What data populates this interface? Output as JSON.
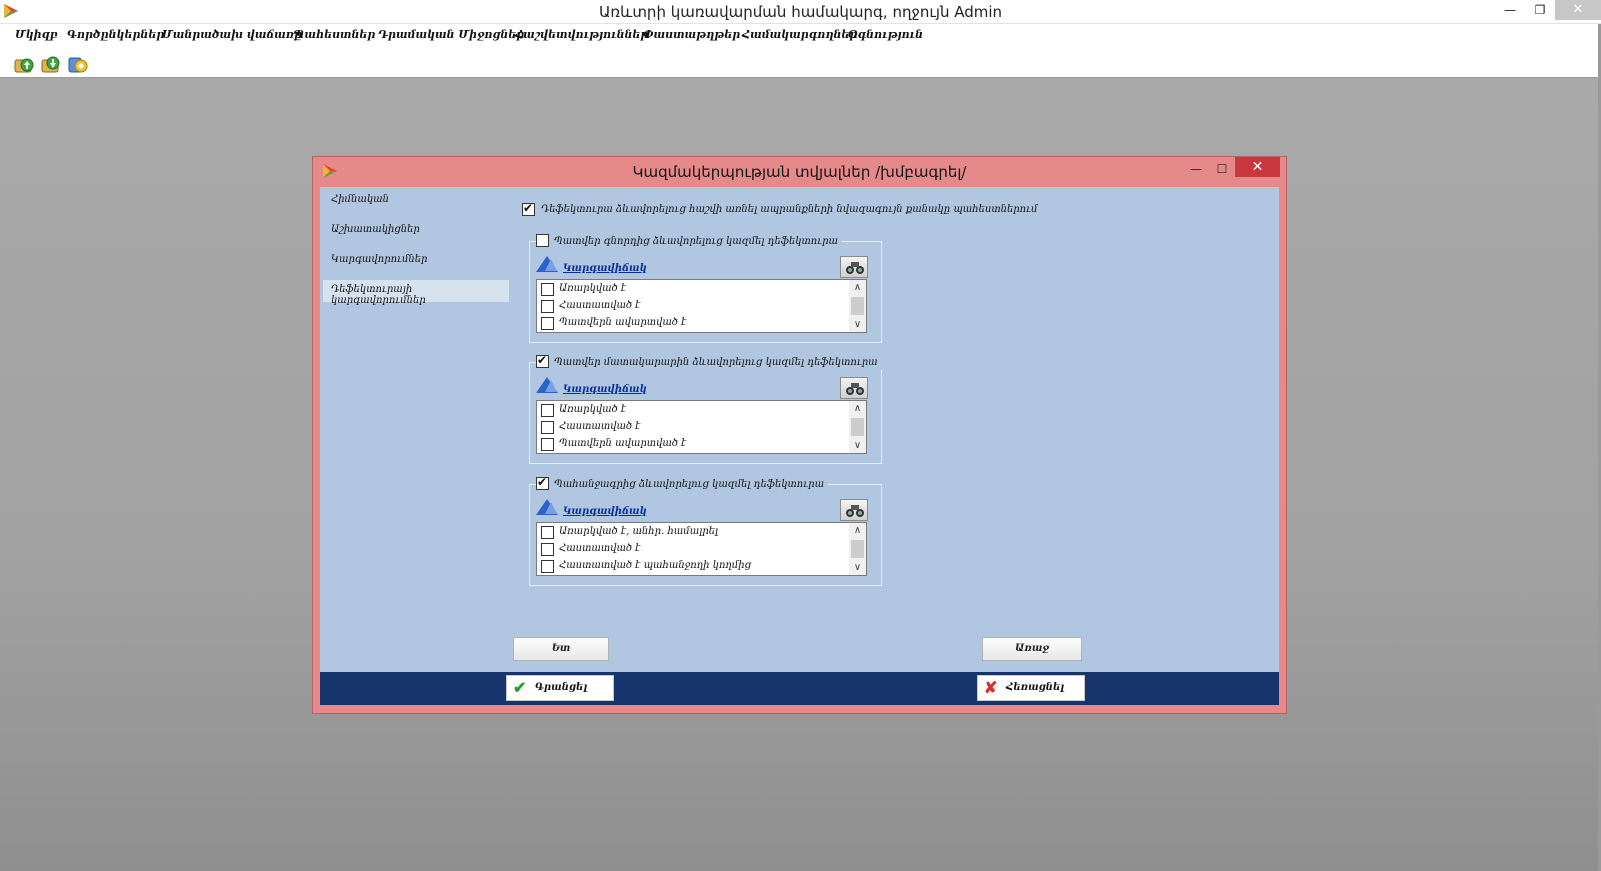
{
  "window": {
    "title": "Առևտրի կառավարման համակարգ, ողջույն Admin",
    "minimize": "—",
    "restore": "❐",
    "close": "✕"
  },
  "menu": [
    {
      "label": "Մկիզբ"
    },
    {
      "label": "Գործընկերներ"
    },
    {
      "label": "Մանրածախ վաճառք"
    },
    {
      "label": "Պահեստներ"
    },
    {
      "label": "Դրամական Միջոցներ"
    },
    {
      "label": "Հաշվետվություններ"
    },
    {
      "label": "Փաստաթղթեր"
    },
    {
      "label": "Համակարգողներ"
    },
    {
      "label": "Օգնություն"
    }
  ],
  "toolbar": {
    "icons": [
      "upload-arrow-icon",
      "download-arrow-icon",
      "settings-gear-icon"
    ]
  },
  "dialog": {
    "title": "Կազմակերպության տվյալներ /խմբագրել/",
    "minimize": "—",
    "maximize": "☐",
    "close": "✕",
    "nav": [
      {
        "label": "Հիմնական"
      },
      {
        "label": "Աշխատակիցներ"
      },
      {
        "label": "Կարգավորումներ"
      },
      {
        "label": "Դեֆեկտուրայի կարգավորումներ"
      }
    ],
    "top_option": {
      "label": "Դեֆեկտուրա ձևավորելուց հաշվի առնել ապրանքների նվազագույն քանակը պահեստներում",
      "checked": true
    },
    "groups": [
      {
        "label": "Պատվեր գնորդից ձևավորելուց կազմել դեֆեկտուրա",
        "checked": false,
        "link": "Կարգավիճակ",
        "items": [
          {
            "label": "Առարկված է",
            "checked": false
          },
          {
            "label": "Հաստատված է",
            "checked": false
          },
          {
            "label": "Պատվերն ավարտված է",
            "checked": false
          }
        ]
      },
      {
        "label": "Պատվեր մատակարարին ձևավորելուց կազմել դեֆեկտուրա",
        "checked": true,
        "link": "Կարգավիճակ",
        "items": [
          {
            "label": "Առարկված է",
            "checked": false
          },
          {
            "label": "Հաստատված է",
            "checked": false
          },
          {
            "label": "Պատվերն ավարտված է",
            "checked": false
          }
        ]
      },
      {
        "label": "Պահանջագրից ձևավորելուց կազմել դեֆեկտուրա",
        "checked": true,
        "link": "Կարգավիճակ",
        "items": [
          {
            "label": "Առարկված է, անհր. համալրել",
            "checked": false
          },
          {
            "label": "Հաստատված է",
            "checked": false
          },
          {
            "label": "Հաստատված է պահանջողի կողմից",
            "checked": false
          }
        ]
      }
    ],
    "back_label": "Ետ",
    "next_label": "Առաջ",
    "save_label": "Գրանցել",
    "cancel_label": "Հեռացնել"
  },
  "colors": {
    "dialog_frame": "#e6898b",
    "dialog_body": "#b1c6e0",
    "footer_bar": "#17346c",
    "close_button": "#c8383e",
    "link": "#0a2f9c"
  }
}
